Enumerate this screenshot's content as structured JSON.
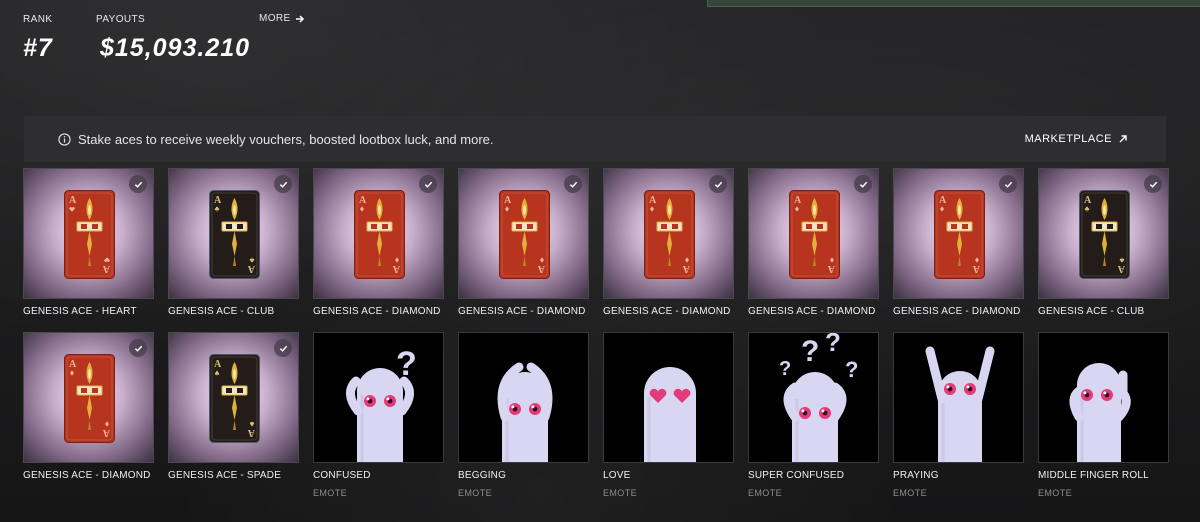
{
  "stats": {
    "rank_label": "RANK",
    "rank_value": "#7",
    "payouts_label": "PAYOUTS",
    "payouts_value": "$15,093.210",
    "more_label": "MORE"
  },
  "info_bar": {
    "text": "Stake aces to receive weekly vouchers, boosted lootbox luck, and more.",
    "marketplace_label": "MARKETPLACE"
  },
  "colors": {
    "heart_diamond_card": "#b7351f",
    "club_spade_card": "#241c18",
    "gold": "#e2b03a",
    "emote_body": "#d9d6f2",
    "emote_eye": "#e23b7a"
  },
  "items": [
    {
      "name": "GENESIS ACE - HEART",
      "kind": "ace",
      "suit": "heart",
      "checked": true
    },
    {
      "name": "GENESIS ACE - CLUB",
      "kind": "ace",
      "suit": "club",
      "checked": true
    },
    {
      "name": "GENESIS ACE - DIAMOND",
      "kind": "ace",
      "suit": "diamond",
      "checked": true
    },
    {
      "name": "GENESIS ACE - DIAMOND",
      "kind": "ace",
      "suit": "diamond",
      "checked": true
    },
    {
      "name": "GENESIS ACE - DIAMOND",
      "kind": "ace",
      "suit": "diamond",
      "checked": true
    },
    {
      "name": "GENESIS ACE - DIAMOND",
      "kind": "ace",
      "suit": "diamond",
      "checked": true
    },
    {
      "name": "GENESIS ACE - DIAMOND",
      "kind": "ace",
      "suit": "diamond",
      "checked": true
    },
    {
      "name": "GENESIS ACE - CLUB",
      "kind": "ace",
      "suit": "club",
      "checked": true
    },
    {
      "name": "GENESIS ACE - DIAMOND",
      "kind": "ace",
      "suit": "diamond",
      "checked": true
    },
    {
      "name": "GENESIS ACE - SPADE",
      "kind": "ace",
      "suit": "spade",
      "checked": true
    },
    {
      "name": "CONFUSED",
      "kind": "emote",
      "pose": "confused",
      "type_label": "EMOTE"
    },
    {
      "name": "BEGGING",
      "kind": "emote",
      "pose": "begging",
      "type_label": "EMOTE"
    },
    {
      "name": "LOVE",
      "kind": "emote",
      "pose": "love",
      "type_label": "EMOTE"
    },
    {
      "name": "SUPER CONFUSED",
      "kind": "emote",
      "pose": "super-confused",
      "type_label": "EMOTE"
    },
    {
      "name": "PRAYING",
      "kind": "emote",
      "pose": "praying",
      "type_label": "EMOTE"
    },
    {
      "name": "MIDDLE FINGER ROLL",
      "kind": "emote",
      "pose": "middle-finger-roll",
      "type_label": "EMOTE"
    }
  ]
}
